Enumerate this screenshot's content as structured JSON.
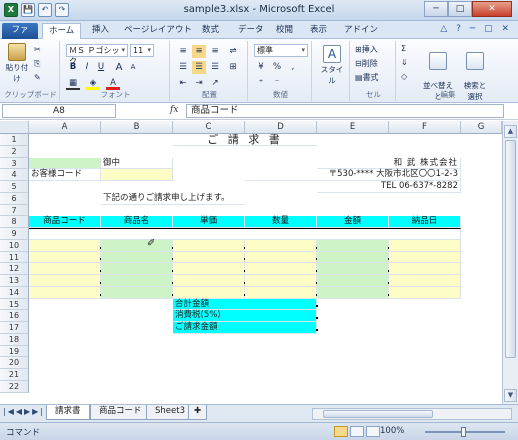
{
  "window": {
    "title": "sample3.xlsx - Microsoft Excel",
    "controls": [
      "─",
      "□",
      "✕"
    ]
  },
  "quick_access": [
    "X",
    "💾",
    "↶",
    "↷"
  ],
  "ribbon_tabs": [
    "ファイル",
    "ホーム",
    "挿入",
    "ページレイアウト",
    "数式",
    "データ",
    "校閲",
    "表示",
    "アドイン"
  ],
  "ribbon_tab_right": "△ ? ─ ▢ ✕",
  "ribbon": {
    "clipboard": {
      "paste": "貼り付け",
      "label": "クリップボード"
    },
    "font": {
      "name": "ＭＳ Ｐゴシック",
      "size": "11",
      "bold": "B",
      "italic": "I",
      "underline": "U",
      "grow": "A",
      "shrink": "A",
      "label": "フォント"
    },
    "alignment": {
      "label": "配置"
    },
    "number": {
      "format": "標準",
      "label": "数値"
    },
    "style": {
      "label": "スタイル"
    },
    "cells": {
      "insert": "挿入",
      "delete": "削除",
      "format": "書式",
      "label": "セル"
    },
    "editing": {
      "sigma": "Σ",
      "sort": "並べ替えと\nフィルター",
      "find": "検索と\n選択",
      "label": "編集"
    }
  },
  "formula_bar": {
    "name_box": "A8",
    "fx": "fx",
    "value": "商品コード"
  },
  "columns": [
    "A",
    "B",
    "C",
    "D",
    "E",
    "F",
    "G"
  ],
  "rows": [
    "1",
    "2",
    "3",
    "4",
    "5",
    "6",
    "7",
    "8",
    "9",
    "10",
    "11",
    "12",
    "13",
    "14",
    "15",
    "16",
    "17",
    "18",
    "19",
    "20",
    "21",
    "22"
  ],
  "cells": {
    "c1": "ご 請 求 書",
    "b3": "御中",
    "e3": "和 武 株式会社",
    "a4": "お客様コード",
    "d4": "〒530-****  大阪市北区〇〇1-2-3",
    "e5": "TEL  06-637*-8282",
    "b6": "下記の通りご請求申し上げます。",
    "a8": "商品コード",
    "b8": "商品名",
    "c8": "単価",
    "d8": "数量",
    "e8": "金額",
    "f8": "納品日",
    "c15": "合計金額",
    "c16": "消費税(5%)",
    "c17": "ご請求金額"
  },
  "sheets": [
    "請求書",
    "商品コード",
    "Sheet3"
  ],
  "active_sheet": "請求書",
  "status": {
    "mode": "コマンド",
    "zoom": "100%"
  },
  "colors": {
    "cyan": "#00ffff",
    "green": "#cdf3c7",
    "yellow": "#fdfdc6"
  }
}
